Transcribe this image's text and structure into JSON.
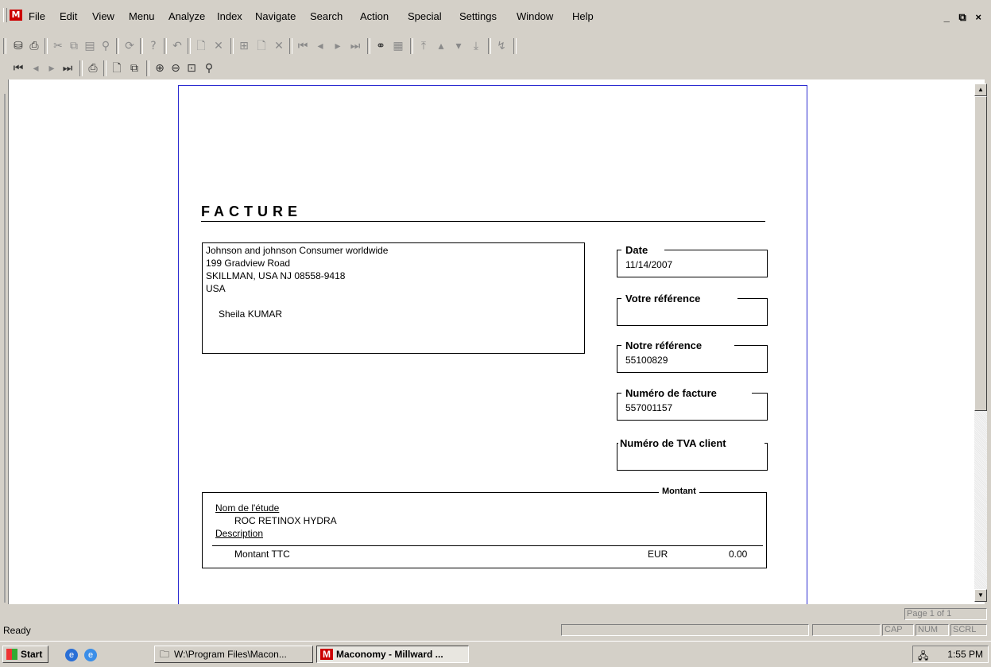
{
  "menubar": {
    "app_icon": "M",
    "items": [
      "File",
      "Edit",
      "View",
      "Menu",
      "Analyze",
      "Index",
      "Navigate",
      "Search",
      "Action",
      "Special",
      "Settings",
      "Window",
      "Help"
    ],
    "window_controls": "_ ⧉ ×"
  },
  "toolbar1": {
    "icons": [
      "database-icon",
      "print-icon",
      "cut-icon",
      "copy-icon",
      "paste-icon",
      "find-icon",
      "refresh-icon",
      "help-icon",
      "undo-icon",
      "new-icon",
      "delete-icon",
      "insert-icon",
      "new-record-icon",
      "close-record-icon",
      "first-icon",
      "prev-icon",
      "next-icon",
      "last-icon",
      "binoculars-icon",
      "filter-icon",
      "top-icon",
      "up-icon",
      "down-icon",
      "bottom-icon",
      "sort-icon"
    ]
  },
  "toolbar2": {
    "icons": [
      "first-page-icon",
      "prev-page-icon",
      "next-page-icon",
      "last-page-icon",
      "print-icon",
      "page-icon",
      "pages-icon",
      "zoom-in-icon",
      "zoom-out-icon",
      "zoom-fit-icon",
      "zoom-icon"
    ]
  },
  "invoice": {
    "title": "FACTURE",
    "address": {
      "line1": "Johnson and johnson Consumer worldwide",
      "line2": "199 Gradview Road",
      "line3": "SKILLMAN, USA NJ 08558-9418",
      "line4": "USA",
      "contact": "Sheila KUMAR"
    },
    "fields": {
      "date_label": "Date",
      "date_value": "11/14/2007",
      "your_ref_label": "Votre référence",
      "your_ref_value": "",
      "our_ref_label": "Notre référence",
      "our_ref_value": "55100829",
      "invoice_no_label": "Numéro de facture",
      "invoice_no_value": "557001157",
      "vat_label": "Numéro de TVA client",
      "vat_value": ""
    },
    "amount": {
      "header": "Montant",
      "study_label": "Nom de l'étude",
      "study_value": "ROC RETINOX HYDRA",
      "description_label": "Description",
      "total_label": "Montant TTC",
      "currency": "EUR",
      "total_value": "0.00"
    }
  },
  "statusbar": {
    "status": "Ready",
    "page_indicator": "Page 1 of 1",
    "cap": "CAP",
    "num": "NUM",
    "scrl": "SCRL"
  },
  "taskbar": {
    "start": "Start",
    "task1": "W:\\Program Files\\Macon...",
    "task2": "Maconomy - Millward ...",
    "clock": "1:55 PM"
  }
}
